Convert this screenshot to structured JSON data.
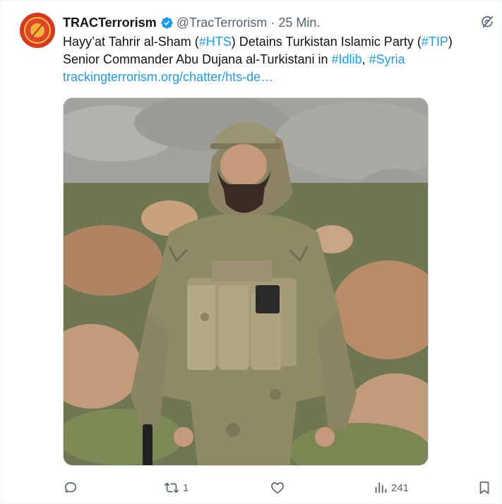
{
  "tweet": {
    "author_name": "TRACTerrorism",
    "handle": "@TracTerrorism",
    "separator": "·",
    "time": "25 Min.",
    "text": {
      "l1_a": "Hayy’at Tahrir al-Sham (",
      "l1_tag1": "#HTS",
      "l1_b": ") Detains Turkistan Islamic Party (",
      "l1_tag2": "#TIP",
      "l1_c": ")",
      "l2_a": "Senior Commander Abu Dujana al-Turkistani in ",
      "l2_tag1": "#Idlib",
      "l2_b": ", ",
      "l2_tag2": "#Syria",
      "link": "trackingterrorism.org/chatter/hts-de…"
    }
  },
  "actions": {
    "replies": "",
    "reposts": "1",
    "likes": "",
    "views": "241"
  },
  "colors": {
    "link": "#1d9bf0",
    "verified": "#1d9bf0",
    "muted": "#536471",
    "avatar": "#d93a1f"
  },
  "icons": {
    "verified": "verified-badge-icon",
    "grok": "grok-icon",
    "reply": "reply-icon",
    "repost": "repost-icon",
    "like": "like-icon",
    "views": "views-icon",
    "bookmark": "bookmark-icon"
  }
}
